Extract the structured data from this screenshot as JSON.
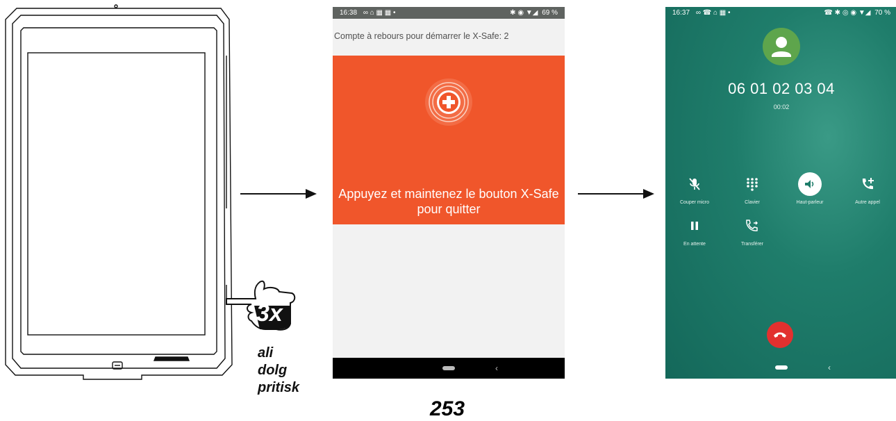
{
  "illustration": {
    "press_count": "3x",
    "hint_lines": [
      "ali",
      "dolg",
      "pritisk"
    ]
  },
  "countdown_screen": {
    "status_time": "16:38",
    "status_icons_left": "∞ ⌂ ▦ ▦ •",
    "status_icons_right": "✱ ◉ ▼◢",
    "battery": "69 %",
    "countdown_label": "Compte à rebours pour démarrer le X-Safe: 2",
    "panel_message": "Appuyez et maintenez le bouton X-Safe pour quitter",
    "panel_color": "#f0562b",
    "icon": "sos-plus-icon"
  },
  "call_screen": {
    "status_time": "16:37",
    "status_icons_left": "∞ ☎ ⌂ ▦ •",
    "status_icons_right": "☎ ✱ ◎ ◉ ▼◢",
    "battery": "70 %",
    "number": "06 01 02 03 04",
    "timer": "00:02",
    "controls": [
      {
        "label": "Couper micro",
        "icon": "mic-off-icon"
      },
      {
        "label": "Clavier",
        "icon": "dialpad-icon"
      },
      {
        "label": "Haut-parleur",
        "icon": "speaker-icon",
        "active": true
      },
      {
        "label": "Autre appel",
        "icon": "add-call-icon"
      },
      {
        "label": "En attente",
        "icon": "pause-icon"
      },
      {
        "label": "Transférer",
        "icon": "transfer-icon"
      }
    ],
    "hangup_color": "#e2302f"
  },
  "page_number": "253"
}
